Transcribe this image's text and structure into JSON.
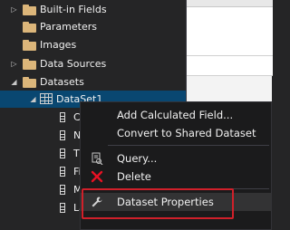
{
  "tree": {
    "items": [
      {
        "label": "Built-in Fields",
        "expandable": true
      },
      {
        "label": "Parameters",
        "expandable": false
      },
      {
        "label": "Images",
        "expandable": false
      },
      {
        "label": "Data Sources",
        "expandable": true
      },
      {
        "label": "Datasets",
        "expandable": true,
        "expanded": true
      }
    ],
    "dataset": {
      "label": "DataSet1",
      "selected": true
    },
    "fields": [
      "Cu",
      "Na",
      "Tit",
      "Fir",
      "Mi",
      "La"
    ]
  },
  "context_menu": {
    "items": [
      {
        "label": "Add Calculated Field...",
        "icon": "none"
      },
      {
        "label": "Convert to Shared Dataset",
        "icon": "none"
      },
      {
        "label": "Query...",
        "icon": "query-icon"
      },
      {
        "label": "Delete",
        "icon": "delete-x-icon"
      },
      {
        "label": "Dataset Properties",
        "icon": "wrench-icon",
        "highlighted": true
      }
    ]
  },
  "colors": {
    "background": "#252526",
    "selection": "#094771",
    "folder": "#dcb67a",
    "menu_bg": "#1b1b1c",
    "highlight_border": "#d0202a",
    "delete_icon": "#e81123"
  }
}
